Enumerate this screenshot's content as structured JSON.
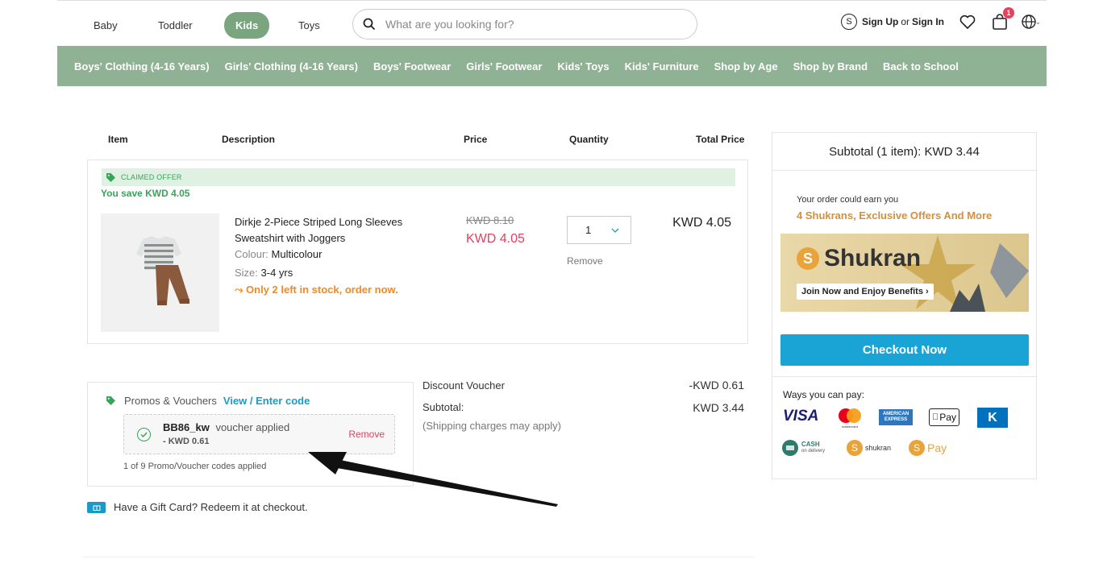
{
  "header": {
    "categories": [
      {
        "label": "Baby",
        "active": false
      },
      {
        "label": "Toddler",
        "active": false
      },
      {
        "label": "Kids",
        "active": true
      },
      {
        "label": "Toys",
        "active": false
      }
    ],
    "search_placeholder": "What are you looking for?",
    "signup": "Sign Up",
    "or": "or",
    "signin": "Sign In",
    "cart_count": "1"
  },
  "nav": [
    "Boys' Clothing (4-16 Years)",
    "Girls' Clothing (4-16 Years)",
    "Boys' Footwear",
    "Girls' Footwear",
    "Kids' Toys",
    "Kids' Furniture",
    "Shop by Age",
    "Shop by Brand",
    "Back to School"
  ],
  "table": {
    "headers": {
      "item": "Item",
      "description": "Description",
      "price": "Price",
      "quantity": "Quantity",
      "total": "Total Price"
    }
  },
  "cart_item": {
    "offer_label": "CLAIMED OFFER",
    "you_save": "You save  KWD 4.05",
    "name": "Dirkje 2-Piece Striped Long Sleeves Sweatshirt with Joggers",
    "colour_label": "Colour:",
    "colour": "Multicolour",
    "size_label": "Size:",
    "size": "3-4 yrs",
    "stock": "⤳ Only 2 left in stock, order now.",
    "old_price": "KWD 8.10",
    "new_price": "KWD 4.05",
    "quantity": "1",
    "remove": "Remove",
    "total": "KWD 4.05"
  },
  "promo": {
    "title": "Promos & Vouchers",
    "link": "View / Enter code",
    "code": "BB86_kw",
    "applied": "voucher applied",
    "amount": "- KWD 0.61",
    "remove": "Remove",
    "count": "1 of 9 Promo/Voucher codes applied"
  },
  "gift_card": "Have a Gift Card? Redeem it at checkout.",
  "summary": {
    "discount_label": "Discount Voucher",
    "discount_value": "-KWD 0.61",
    "subtotal_label": "Subtotal:",
    "subtotal_value": "KWD 3.44",
    "shipping_note": "(Shipping charges may apply)"
  },
  "right_panel": {
    "subtotal_header": "Subtotal (1 item):  KWD 3.44",
    "earn_small": "Your order could earn you",
    "earn_bold": "4 Shukrans, Exclusive Offers And More",
    "shukran_brand": "Shukran",
    "join": "Join Now and Enjoy Benefits  ›",
    "checkout": "Checkout Now",
    "pay_title": "Ways you can pay:",
    "pay_methods": {
      "visa": "VISA",
      "mastercard": "mastercard",
      "amex_top": "AMERICAN",
      "amex_bottom": "EXPRESS",
      "applepay": "Pay",
      "knet": "K",
      "cash_top": "CASH",
      "cash_bottom": "on delivery",
      "shukran": "shukran",
      "spay": "Pay"
    }
  },
  "colors": {
    "green_nav": "#8fb194",
    "active_tab": "#7aa57f",
    "accent_blue": "#1aa4d6",
    "price_red": "#e8405b",
    "offer_green": "#3aa35a",
    "shukran_gold": "#d4903a"
  }
}
